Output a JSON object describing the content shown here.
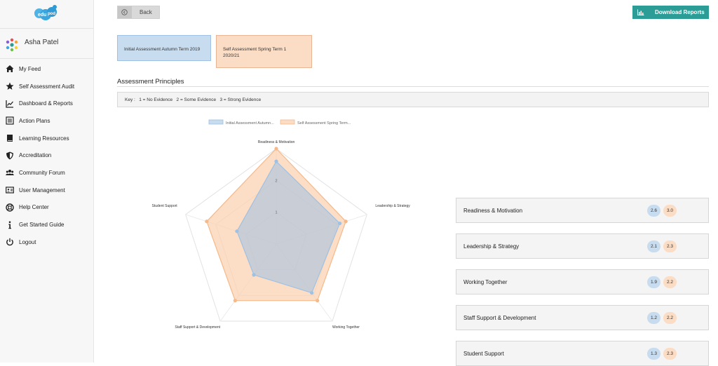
{
  "user": {
    "name": "Asha Patel"
  },
  "sidebar": {
    "items": [
      {
        "label": "My Feed",
        "icon": "home-icon"
      },
      {
        "label": "Self Assessment Audit",
        "icon": "star-icon"
      },
      {
        "label": "Dashboard & Reports",
        "icon": "chart-line-icon"
      },
      {
        "label": "Action Plans",
        "icon": "list-icon"
      },
      {
        "label": "Learning Resources",
        "icon": "book-icon"
      },
      {
        "label": "Accreditation",
        "icon": "shield-icon"
      },
      {
        "label": "Community Forum",
        "icon": "users-icon"
      },
      {
        "label": "User Management",
        "icon": "id-card-icon"
      },
      {
        "label": "Help Center",
        "icon": "help-icon"
      },
      {
        "label": "Get Started Guide",
        "icon": "info-icon"
      },
      {
        "label": "Logout",
        "icon": "power-icon"
      }
    ]
  },
  "toolbar": {
    "back_label": "Back",
    "download_label": "Download Reports"
  },
  "assessments": [
    {
      "label": "Initial Assessment Autumn Term 2019"
    },
    {
      "label": "Self Assessment Spring Term 1 2020/21"
    }
  ],
  "principles": {
    "title": "Assessment Principles",
    "key": "Key :   1 = No Evidence   2 = Some Evidence   3 = Strong Evidence"
  },
  "colors": {
    "accent": "#2b9d96",
    "series_blue": "#c8dcef",
    "series_orange": "#fbdcc4"
  },
  "chart_data": {
    "type": "radar",
    "categories": [
      "Readiness & Motivation",
      "Leadership & Strategy",
      "Working Together",
      "Staff Support & Development",
      "Student Support"
    ],
    "series": [
      {
        "name": "Initial Assessment Autumn...",
        "values": [
          2.6,
          2.1,
          1.9,
          1.2,
          1.3
        ],
        "color": "#9fc1e3"
      },
      {
        "name": "Self Assessment Spring Term...",
        "values": [
          3.0,
          2.3,
          2.2,
          2.2,
          2.3
        ],
        "color": "#f5b98a"
      }
    ],
    "tick_labels": [
      "1",
      "2"
    ],
    "rlim": [
      0,
      3
    ]
  },
  "scores": [
    {
      "label": "Readiness & Motivation",
      "initial": "2.6",
      "spring": "3.0"
    },
    {
      "label": "Leadership & Strategy",
      "initial": "2.1",
      "spring": "2.3"
    },
    {
      "label": "Working Together",
      "initial": "1.9",
      "spring": "2.2"
    },
    {
      "label": "Staff Support & Development",
      "initial": "1.2",
      "spring": "2.2"
    },
    {
      "label": "Student Support",
      "initial": "1.3",
      "spring": "2.3"
    }
  ]
}
